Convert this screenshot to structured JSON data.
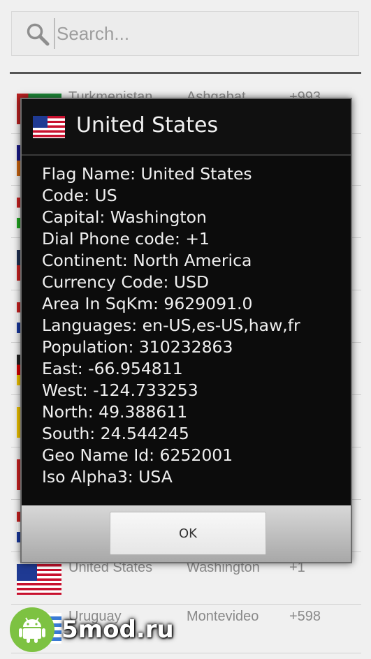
{
  "search": {
    "placeholder": "Search..."
  },
  "list": {
    "rows": [
      {
        "name": "Turkmenistan",
        "capital": "Ashgabat",
        "dial": "+993",
        "flag": "flag-tm"
      },
      {
        "name": "",
        "capital": "",
        "dial": "",
        "flag": "flag-generic-1"
      },
      {
        "name": "",
        "capital": "",
        "dial": "",
        "flag": "flag-generic-2"
      },
      {
        "name": "",
        "capital": "",
        "dial": "",
        "flag": "flag-generic-3"
      },
      {
        "name": "",
        "capital": "",
        "dial": "",
        "flag": "flag-generic-8"
      },
      {
        "name": "",
        "capital": "",
        "dial": "",
        "flag": "flag-generic-5"
      },
      {
        "name": "",
        "capital": "",
        "dial": "",
        "flag": "flag-generic-6"
      },
      {
        "name": "",
        "capital": "",
        "dial": "",
        "flag": "flag-generic-7"
      },
      {
        "name": "",
        "capital": "",
        "dial": "",
        "flag": "flag-generic-8"
      },
      {
        "name": "United States",
        "capital": "Washington",
        "dial": "+1",
        "flag": "flag-stripes-us"
      },
      {
        "name": "Uruguay",
        "capital": "Montevideo",
        "dial": "+598",
        "flag": "flag-uy"
      }
    ]
  },
  "dialog": {
    "title": "United States",
    "lines": [
      "Flag Name: United States",
      "Code: US",
      "Capital: Washington",
      "Dial Phone code: +1",
      "Continent: North America",
      "Currency Code: USD",
      "Area In SqKm: 9629091.0",
      "Languages: en-US,es-US,haw,fr",
      "Population: 310232863",
      "East: -66.954811",
      "West: -124.733253",
      "North: 49.388611",
      "South: 24.544245",
      "Geo Name Id: 6252001",
      "Iso Alpha3: USA"
    ],
    "ok_label": "OK"
  },
  "watermark": {
    "text": "5mod.ru"
  }
}
